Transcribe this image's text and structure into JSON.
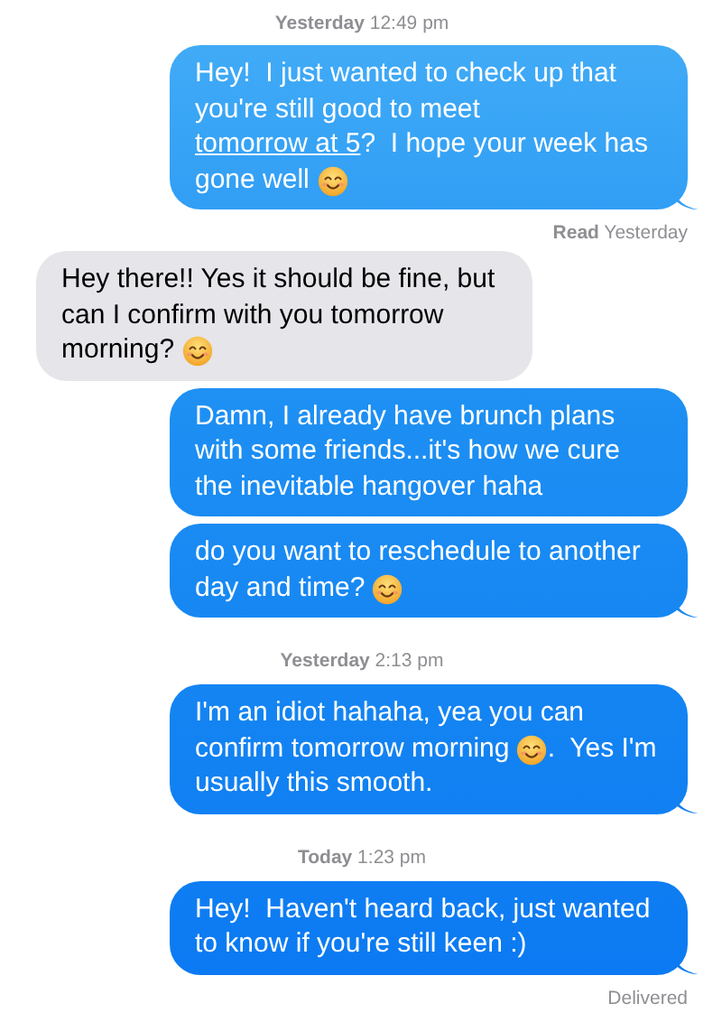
{
  "thread": [
    {
      "kind": "timestamp",
      "text": "**Yesterday** 12:49 pm"
    },
    {
      "kind": "sent",
      "tail": true,
      "parts": [
        {
          "kind": "text",
          "text": "Hey!  I just wanted to check up that you're still good to meet "
        },
        {
          "kind": "link",
          "text": "tomorrow at 5"
        },
        {
          "kind": "text",
          "text": "?  I hope your week has gone well "
        },
        {
          "kind": "emoji"
        }
      ]
    },
    {
      "kind": "receipt",
      "text": "**Read** Yesterday"
    },
    {
      "kind": "received",
      "parts": [
        {
          "kind": "text",
          "text": "Hey there!! Yes it should be fine, but can I confirm with you tomorrow morning? "
        },
        {
          "kind": "emoji"
        }
      ]
    },
    {
      "kind": "sent",
      "tail": false,
      "parts": [
        {
          "kind": "text",
          "text": "Damn, I already have brunch plans with some friends...it's how we cure the inevitable hangover haha"
        }
      ]
    },
    {
      "kind": "sent",
      "tail": true,
      "parts": [
        {
          "kind": "text",
          "text": "do you want to reschedule to another day and time? "
        },
        {
          "kind": "emoji"
        }
      ]
    },
    {
      "kind": "timestamp",
      "text": "**Yesterday** 2:13 pm"
    },
    {
      "kind": "sent",
      "tail": true,
      "parts": [
        {
          "kind": "text",
          "text": "I'm an idiot hahaha, yea you can confirm tomorrow morning "
        },
        {
          "kind": "emoji"
        },
        {
          "kind": "text",
          "text": ".  Yes I'm usually this smooth."
        }
      ]
    },
    {
      "kind": "timestamp",
      "text": "**Today** 1:23 pm"
    },
    {
      "kind": "sent",
      "tail": true,
      "parts": [
        {
          "kind": "text",
          "text": "Hey!  Haven't heard back, just wanted to know if you're still keen :)"
        }
      ]
    },
    {
      "kind": "receipt",
      "text": "Delivered"
    }
  ]
}
